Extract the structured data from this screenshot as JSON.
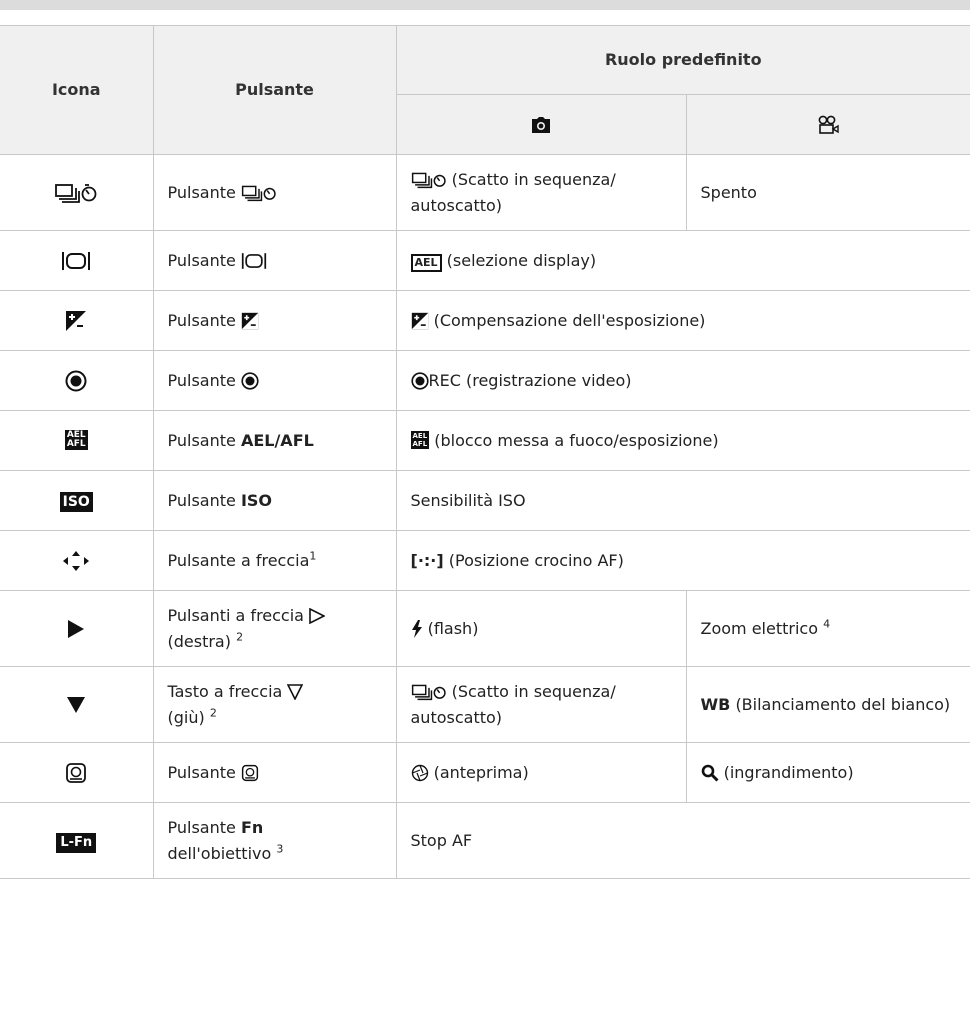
{
  "table": {
    "header": {
      "icona": "Icona",
      "pulsante": "Pulsante",
      "ruolo": "Ruolo predefinito"
    },
    "rows": [
      {
        "button_prefix": "Pulsante",
        "role": "(Scatto in sequenza/ autoscatto)",
        "movie": "Spento"
      },
      {
        "button_prefix": "Pulsante",
        "role": "(selezione display)"
      },
      {
        "button_prefix": "Pulsante",
        "role": "(Compensazione dell'esposizione)"
      },
      {
        "button_prefix": "Pulsante",
        "role": "REC (registrazione video)"
      },
      {
        "button_prefix": "Pulsante",
        "button_bold": "AEL/AFL",
        "role": "(blocco messa a fuoco/esposizione)"
      },
      {
        "icon_text": "ISO",
        "button_prefix": "Pulsante",
        "button_bold": "ISO",
        "role": "Sensibilità ISO"
      },
      {
        "button_prefix": "Pulsante a freccia",
        "button_sup": "1",
        "role": "(Posizione crocino AF)"
      },
      {
        "button_prefix": "Pulsanti a freccia",
        "button_suffix": "(destra)",
        "button_sup": "2",
        "role": "(flash)",
        "movie": "Zoom elettrico",
        "movie_sup": "4"
      },
      {
        "button_prefix": "Tasto a freccia",
        "button_suffix": "(giù)",
        "button_sup": "2",
        "role": "(Scatto in sequenza/ autoscatto)",
        "movie_bold": "WB",
        "movie": "(Bilanciamento del bianco)"
      },
      {
        "button_prefix": "Pulsante",
        "role": "(anteprima)",
        "movie": "(ingrandimento)"
      },
      {
        "icon_text": "L-Fn",
        "button_prefix": "Pulsante",
        "button_bold": "Fn",
        "button_suffix": "dell'obiettivo",
        "button_sup": "3",
        "role": "Stop AF"
      }
    ]
  },
  "icons": {
    "sequential-self-timer": "sequential-selftimer-icon",
    "display": "display-icon",
    "exposure": "exposure-comp-icon",
    "rec": "record-icon",
    "aelafl": "ael-afl-icon",
    "iso": "iso-icon",
    "arrows": "arrow-pad-icon",
    "right": "right-arrow-icon",
    "down": "down-arrow-icon",
    "preview": "preview-icon",
    "lfn": "lens-fn-icon",
    "camera": "camera-icon",
    "movie": "movie-icon"
  }
}
